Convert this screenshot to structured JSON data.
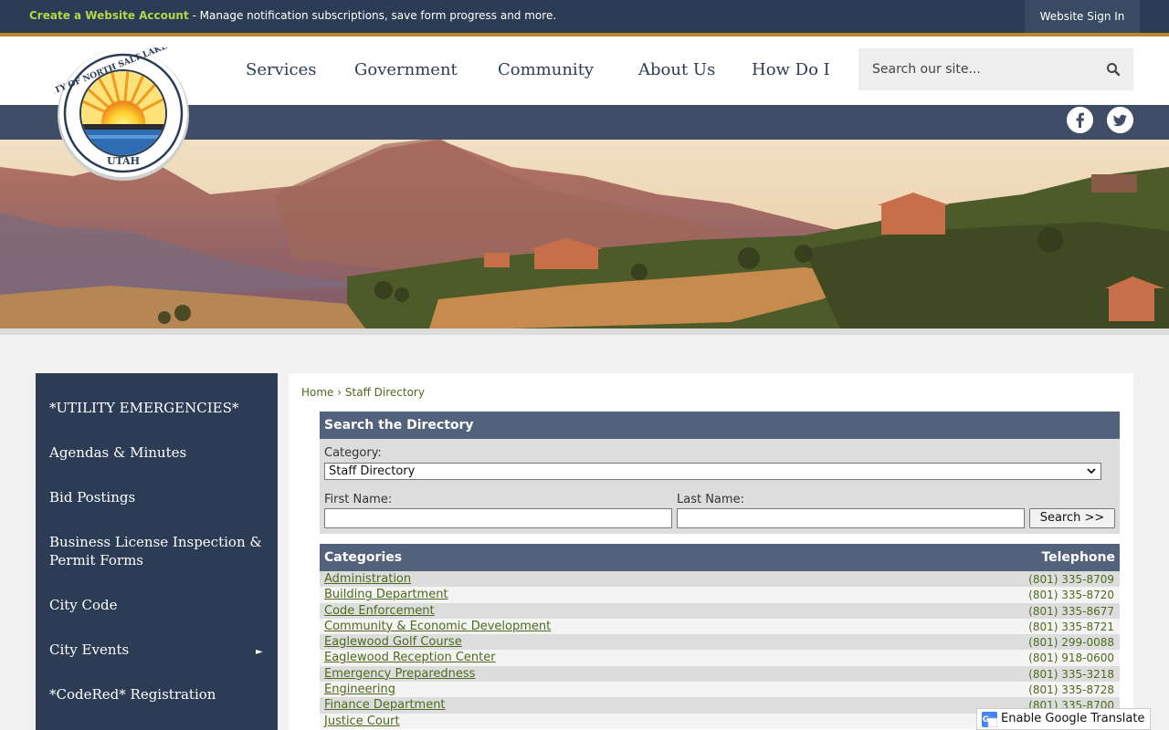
{
  "topbar": {
    "account_link": "Create a Website Account",
    "account_text": " - Manage notification subscriptions, save form progress and more.",
    "signin_label": "Website Sign In"
  },
  "logo": {
    "top_text": "CITY OF NORTH SALT LAKE",
    "bottom_text": "UTAH"
  },
  "nav": {
    "items": [
      {
        "label": "Services"
      },
      {
        "label": "Government"
      },
      {
        "label": "Community"
      },
      {
        "label": "About Us"
      },
      {
        "label": "How Do I"
      }
    ],
    "search_placeholder": "Search our site..."
  },
  "social": [
    "facebook-icon",
    "twitter-icon"
  ],
  "sidebar": {
    "items": [
      {
        "label": "*UTILITY EMERGENCIES*"
      },
      {
        "label": "Agendas & Minutes"
      },
      {
        "label": "Bid Postings"
      },
      {
        "label": "Business License Inspection & Permit Forms"
      },
      {
        "label": "City Code"
      },
      {
        "label": "City Events"
      },
      {
        "label": "*CodeRed* Registration"
      }
    ],
    "arrow": "►"
  },
  "breadcrumb": {
    "home": "Home",
    "separator": "›",
    "current": "Staff Directory"
  },
  "directory": {
    "heading": "Search the Directory",
    "category_label": "Category:",
    "category_value": "Staff Directory",
    "first_name_label": "First Name:",
    "last_name_label": "Last Name:",
    "search_button": "Search >>"
  },
  "categories": {
    "header_left": "Categories",
    "header_right": "Telephone",
    "rows": [
      {
        "name": "Administration",
        "phone": "(801) 335-8709"
      },
      {
        "name": "Building Department",
        "phone": "(801) 335-8720"
      },
      {
        "name": "Code Enforcement",
        "phone": "(801) 335-8677"
      },
      {
        "name": "Community & Economic Development",
        "phone": "(801) 335-8721"
      },
      {
        "name": "Eaglewood Golf Course",
        "phone": "(801) 299-0088"
      },
      {
        "name": "Eaglewood Reception Center",
        "phone": "(801) 918-0600"
      },
      {
        "name": "Emergency Preparedness",
        "phone": "(801) 335-3218"
      },
      {
        "name": "Engineering",
        "phone": "(801) 335-8728"
      },
      {
        "name": "Finance Department",
        "phone": "(801) 335-8700"
      },
      {
        "name": "Justice Court",
        "phone": ""
      }
    ]
  },
  "translate": {
    "label": "Enable Google Translate"
  },
  "colors": {
    "navy": "#2c3c55",
    "accent_green": "#b4d64a",
    "link_green": "#4e6a1c",
    "gold": "#b98a2a"
  }
}
